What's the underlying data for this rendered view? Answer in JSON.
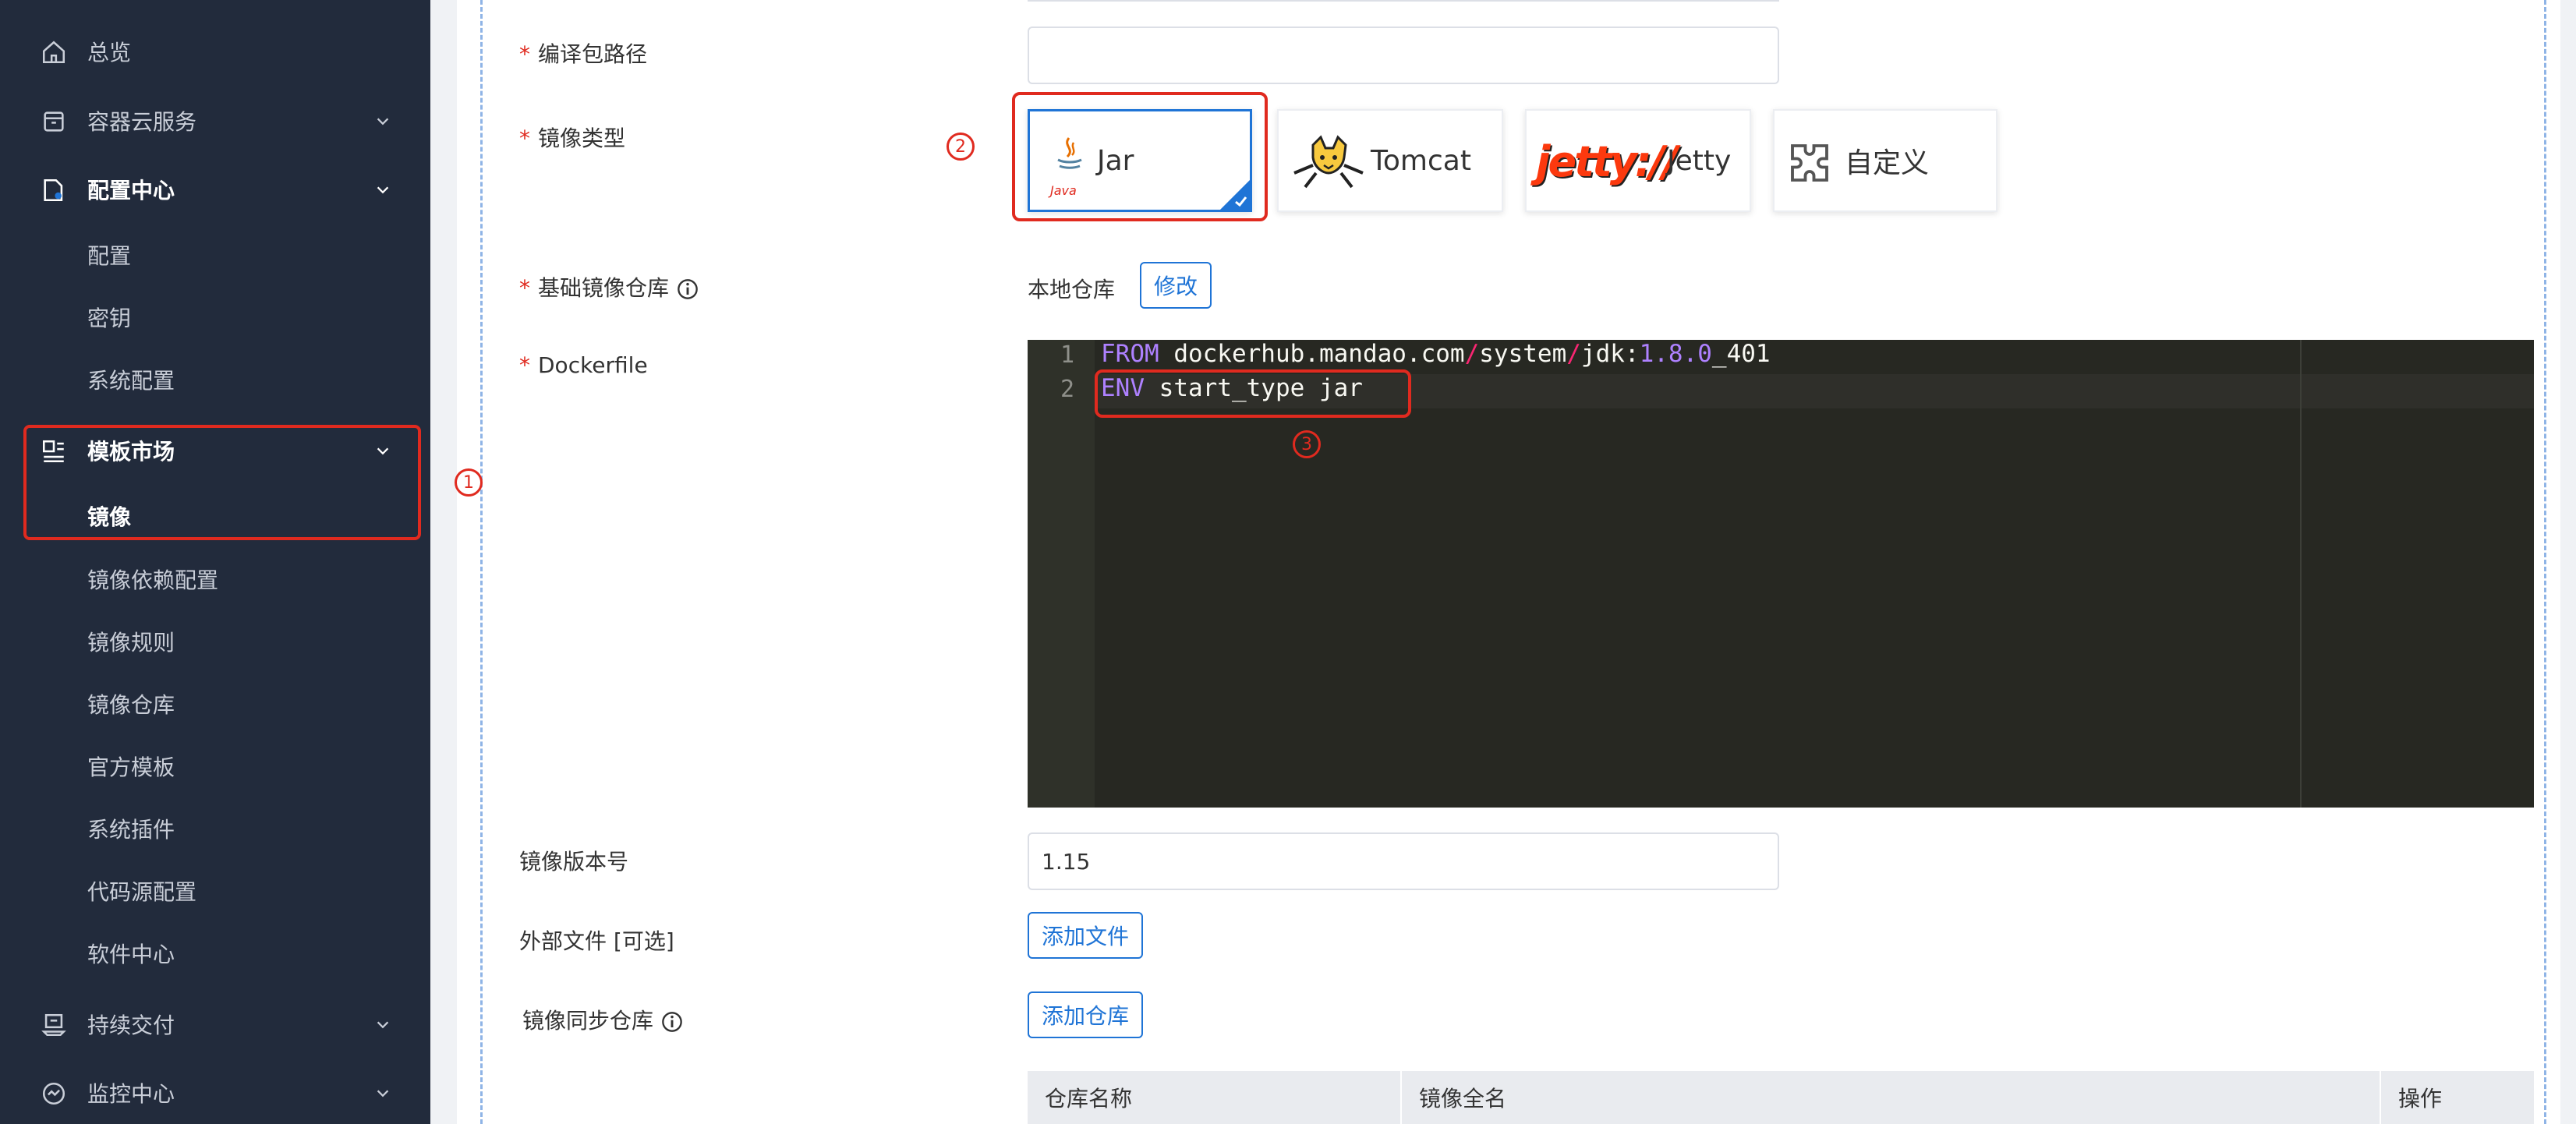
{
  "sidebar": {
    "items": [
      {
        "label": "总览",
        "icon": "home-icon"
      },
      {
        "label": "容器云服务",
        "icon": "container-icon"
      },
      {
        "label": "配置中心",
        "icon": "config-icon"
      },
      {
        "label": "模板市场",
        "icon": "template-icon"
      },
      {
        "label": "持续交付",
        "icon": "delivery-icon"
      },
      {
        "label": "监控中心",
        "icon": "monitor-icon"
      }
    ],
    "config_children": [
      "配置",
      "密钥",
      "系统配置"
    ],
    "template_children": [
      "镜像",
      "镜像依赖配置",
      "镜像规则",
      "镜像仓库",
      "官方模板",
      "系统插件",
      "代码源配置",
      "软件中心"
    ]
  },
  "form": {
    "compile_path": {
      "label": "编译包路径",
      "value": ""
    },
    "image_type": {
      "label": "镜像类型",
      "options": [
        {
          "label": "Jar",
          "logo_text": "Java",
          "selected": true
        },
        {
          "label": "Tomcat",
          "selected": false
        },
        {
          "label": "Jetty",
          "logo_text": "jetty://",
          "selected": false
        },
        {
          "label": "自定义",
          "selected": false
        }
      ]
    },
    "base_repo": {
      "label": "基础镜像仓库",
      "value": "本地仓库",
      "edit_button": "修改"
    },
    "dockerfile": {
      "label": "Dockerfile",
      "line_numbers": [
        "1",
        "2"
      ],
      "line1": {
        "kw": "FROM",
        "part1": " dockerhub.mandao.com",
        "slash1": "/",
        "part2": "system",
        "slash2": "/",
        "part3": "jdk:",
        "version": "1.8.0",
        "part4": "_401"
      },
      "line2": {
        "kw": "ENV",
        "rest": " start_type jar"
      }
    },
    "version": {
      "label": "镜像版本号",
      "value": "1.15"
    },
    "external_files": {
      "label": "外部文件 [可选]",
      "button": "添加文件"
    },
    "sync_repo": {
      "label": "镜像同步仓库",
      "button": "添加仓库"
    }
  },
  "table": {
    "columns": [
      "仓库名称",
      "镜像全名",
      "操作"
    ]
  },
  "annotations": [
    "1",
    "2",
    "3"
  ],
  "colors": {
    "sidebar_bg": "#222b3c",
    "accent": "#1f74d6",
    "required": "#e02a1f",
    "annotation": "#e02a1f",
    "editor_bg": "#272822"
  }
}
